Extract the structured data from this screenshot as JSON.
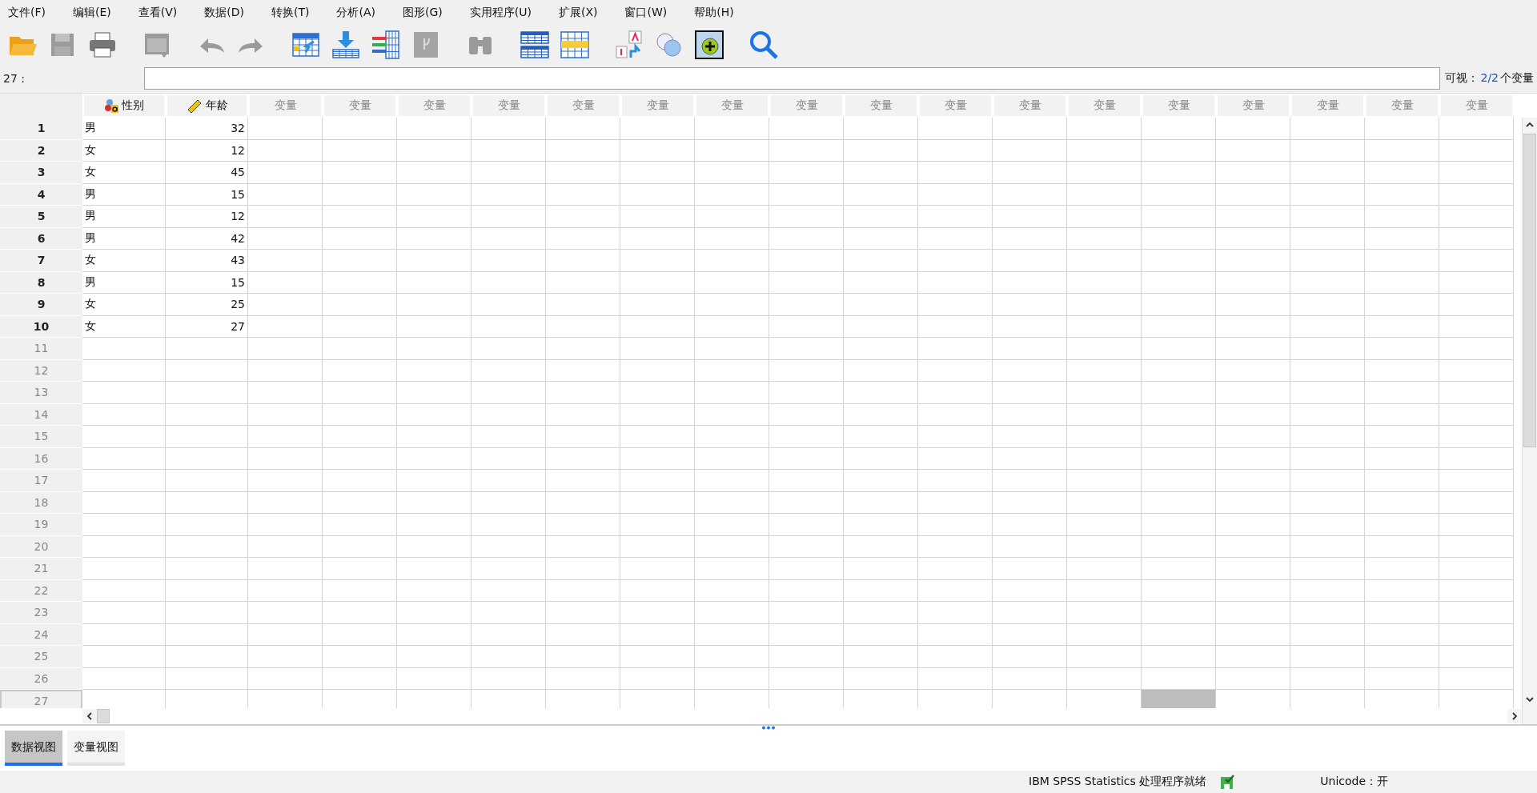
{
  "menu": [
    "文件(F)",
    "编辑(E)",
    "查看(V)",
    "数据(D)",
    "转换(T)",
    "分析(A)",
    "图形(G)",
    "实用程序(U)",
    "扩展(X)",
    "窗口(W)",
    "帮助(H)"
  ],
  "toolbar": {
    "groups": [
      [
        {
          "kind": "open",
          "disabled": false
        },
        {
          "kind": "save",
          "disabled": true
        },
        {
          "kind": "print",
          "disabled": false
        }
      ],
      [
        {
          "kind": "dialog",
          "disabled": true
        }
      ],
      [
        {
          "kind": "undo",
          "disabled": true
        },
        {
          "kind": "redo",
          "disabled": true
        }
      ],
      [
        {
          "kind": "goto-case",
          "disabled": false
        },
        {
          "kind": "goto-var",
          "disabled": false
        },
        {
          "kind": "variables",
          "disabled": false
        },
        {
          "kind": "stats",
          "disabled": true
        }
      ],
      [
        {
          "kind": "find",
          "disabled": true
        }
      ],
      [
        {
          "kind": "insert-cases",
          "disabled": false
        },
        {
          "kind": "insert-var",
          "disabled": false
        }
      ],
      [
        {
          "kind": "labels",
          "disabled": false
        },
        {
          "kind": "sets",
          "disabled": false
        },
        {
          "kind": "add",
          "disabled": false
        }
      ],
      [
        {
          "kind": "search",
          "disabled": false
        }
      ]
    ]
  },
  "cell_editor": {
    "label": "27 :",
    "visible_label": "可视：",
    "visible_count": "2/2",
    "visible_unit": "个变量"
  },
  "columns": [
    {
      "name": "性别",
      "kind": "nominal",
      "selected": false
    },
    {
      "name": "年龄",
      "kind": "scale",
      "selected": false
    },
    {
      "name": "变量",
      "kind": "empty",
      "selected": false
    },
    {
      "name": "变量",
      "kind": "empty",
      "selected": false
    },
    {
      "name": "变量",
      "kind": "empty",
      "selected": false
    },
    {
      "name": "变量",
      "kind": "empty",
      "selected": false
    },
    {
      "name": "变量",
      "kind": "empty",
      "selected": false
    },
    {
      "name": "变量",
      "kind": "empty",
      "selected": false
    },
    {
      "name": "变量",
      "kind": "empty",
      "selected": false
    },
    {
      "name": "变量",
      "kind": "empty",
      "selected": false
    },
    {
      "name": "变量",
      "kind": "empty",
      "selected": false
    },
    {
      "name": "变量",
      "kind": "empty",
      "selected": false
    },
    {
      "name": "变量",
      "kind": "empty",
      "selected": false
    },
    {
      "name": "变量",
      "kind": "empty",
      "selected": false
    },
    {
      "name": "变量",
      "kind": "empty",
      "selected": true
    },
    {
      "name": "变量",
      "kind": "empty",
      "selected": false
    },
    {
      "name": "变量",
      "kind": "empty",
      "selected": false
    },
    {
      "name": "变量",
      "kind": "empty",
      "selected": false
    },
    {
      "name": "变量",
      "kind": "empty",
      "selected": false
    }
  ],
  "rows": [
    {
      "number": "1",
      "cells": [
        "男",
        "32"
      ],
      "selected": false
    },
    {
      "number": "2",
      "cells": [
        "女",
        "12"
      ],
      "selected": false
    },
    {
      "number": "3",
      "cells": [
        "女",
        "45"
      ],
      "selected": false
    },
    {
      "number": "4",
      "cells": [
        "男",
        "15"
      ],
      "selected": false
    },
    {
      "number": "5",
      "cells": [
        "男",
        "12"
      ],
      "selected": false
    },
    {
      "number": "6",
      "cells": [
        "男",
        "42"
      ],
      "selected": false
    },
    {
      "number": "7",
      "cells": [
        "女",
        "43"
      ],
      "selected": false
    },
    {
      "number": "8",
      "cells": [
        "男",
        "15"
      ],
      "selected": false
    },
    {
      "number": "9",
      "cells": [
        "女",
        "25"
      ],
      "selected": false
    },
    {
      "number": "10",
      "cells": [
        "女",
        "27"
      ],
      "selected": false
    },
    {
      "number": "11",
      "selected": false
    },
    {
      "number": "12",
      "selected": false
    },
    {
      "number": "13",
      "selected": false
    },
    {
      "number": "14",
      "selected": false
    },
    {
      "number": "15",
      "selected": false
    },
    {
      "number": "16",
      "selected": false
    },
    {
      "number": "17",
      "selected": false
    },
    {
      "number": "18",
      "selected": false
    },
    {
      "number": "19",
      "selected": false
    },
    {
      "number": "20",
      "selected": false
    },
    {
      "number": "21",
      "selected": false
    },
    {
      "number": "22",
      "selected": false
    },
    {
      "number": "23",
      "selected": false
    },
    {
      "number": "24",
      "selected": false
    },
    {
      "number": "25",
      "selected": false
    },
    {
      "number": "26",
      "selected": false
    },
    {
      "number": "27",
      "selected": true
    }
  ],
  "tabs": [
    {
      "label": "数据视图",
      "selected": true
    },
    {
      "label": "变量视图",
      "selected": false
    }
  ],
  "status_bar": {
    "message": "IBM SPSS Statistics 处理程序就绪",
    "encoding": "Unicode：开"
  }
}
